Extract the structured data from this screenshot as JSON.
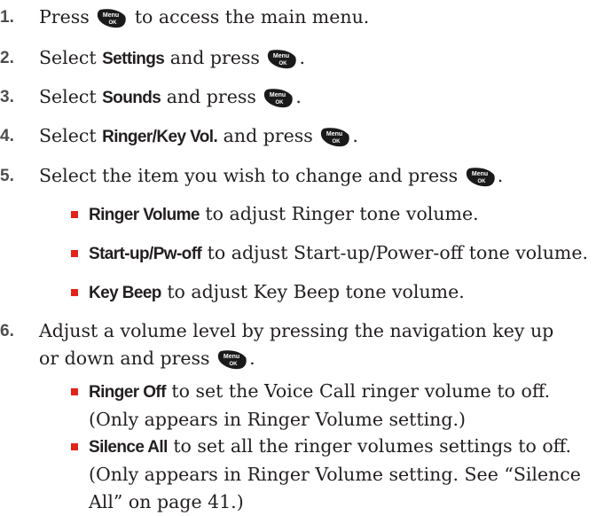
{
  "menu_key": {
    "line1": "Menu",
    "line2": "OK"
  },
  "steps": [
    {
      "num": "1.",
      "pre": "Press ",
      "post": " to access the main menu."
    },
    {
      "num": "2.",
      "pre": "Select ",
      "bold": "Settings",
      "mid": " and press ",
      "post": "."
    },
    {
      "num": "3.",
      "pre": "Select ",
      "bold": "Sounds",
      "mid": " and press ",
      "post": "."
    },
    {
      "num": "4.",
      "pre": "Select ",
      "bold": "Ringer/Key Vol.",
      "mid": " and press ",
      "post": "."
    },
    {
      "num": "5.",
      "text": "Select the item you wish to change and press ",
      "post": "."
    },
    {
      "num": "6.",
      "text": "Adjust a volume level by pressing the navigation key up or down and press ",
      "post": "."
    }
  ],
  "bullets5": [
    {
      "bold": "Ringer Volume",
      "text": " to adjust Ringer tone volume."
    },
    {
      "bold": "Start-up/Pw-off",
      "text": " to adjust Start-up/Power-off tone volume."
    },
    {
      "bold": "Key Beep",
      "text": " to adjust Key Beep tone volume."
    }
  ],
  "bullets6": [
    {
      "bold": "Ringer Off",
      "text": " to set the Voice Call ringer volume to off. (Only appears in Ringer Volume setting.)"
    },
    {
      "bold": "Silence All",
      "text": " to set all the ringer volumes settings to off. (Only appears in Ringer Volume setting. See “Silence All” on page 41.)"
    }
  ],
  "colors": {
    "bullet": "#e2231a",
    "key": "#1a1a1a",
    "number": "#4d4d4f"
  }
}
